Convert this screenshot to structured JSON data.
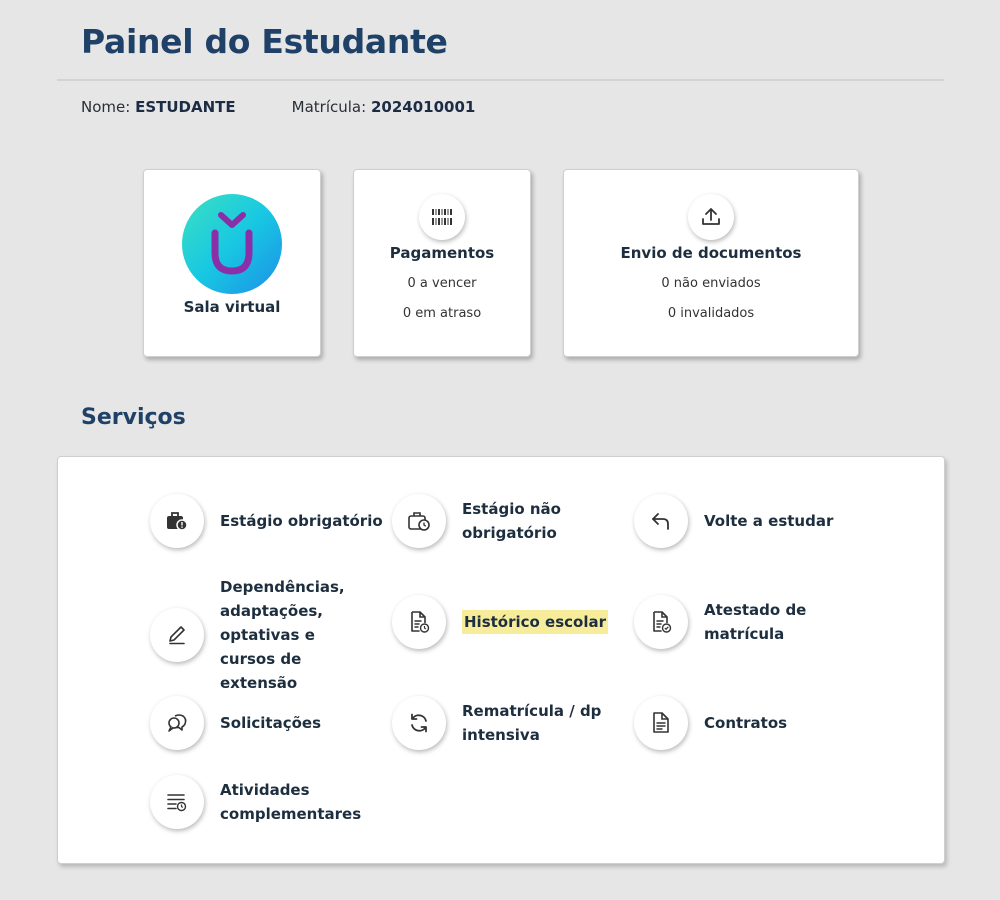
{
  "header": {
    "title": "Painel do Estudante",
    "name_label": "Nome:",
    "name_value": "ESTUDANTE",
    "matricula_label": "Matrícula:",
    "matricula_value": "2024010001"
  },
  "cards": {
    "sala": {
      "label": "Sala virtual",
      "icon": "sala-virtual-logo"
    },
    "pagamentos": {
      "label": "Pagamentos",
      "icon": "barcode-icon",
      "stat1": "0 a vencer",
      "stat2": "0 em atraso"
    },
    "envio": {
      "label": "Envio de documentos",
      "icon": "upload-icon",
      "stat1": "0 não enviados",
      "stat2": "0 invalidados"
    }
  },
  "services": {
    "title": "Serviços",
    "items": [
      {
        "label": "Estágio obrigatório",
        "icon": "briefcase-alert-icon"
      },
      {
        "label": "Estágio não obrigatório",
        "icon": "briefcase-clock-icon"
      },
      {
        "label": "Volte a estudar",
        "icon": "return-arrow-icon"
      },
      {
        "label": "Dependências, adaptações, optativas e cursos de extensão",
        "icon": "pencil-icon"
      },
      {
        "label": "Histórico escolar",
        "icon": "document-clock-icon"
      },
      {
        "label": "Atestado de matrícula",
        "icon": "document-check-icon"
      },
      {
        "label": "Solicitações",
        "icon": "chat-bubbles-icon"
      },
      {
        "label": "Rematrícula / dp intensiva",
        "icon": "refresh-icon"
      },
      {
        "label": "Contratos",
        "icon": "document-icon"
      },
      {
        "label": "Atividades complementares",
        "icon": "list-clock-icon"
      }
    ]
  },
  "colors": {
    "accent": "#1f4168",
    "highlight": "#f7ec9a",
    "logo_letter": "#8a2fa8"
  }
}
